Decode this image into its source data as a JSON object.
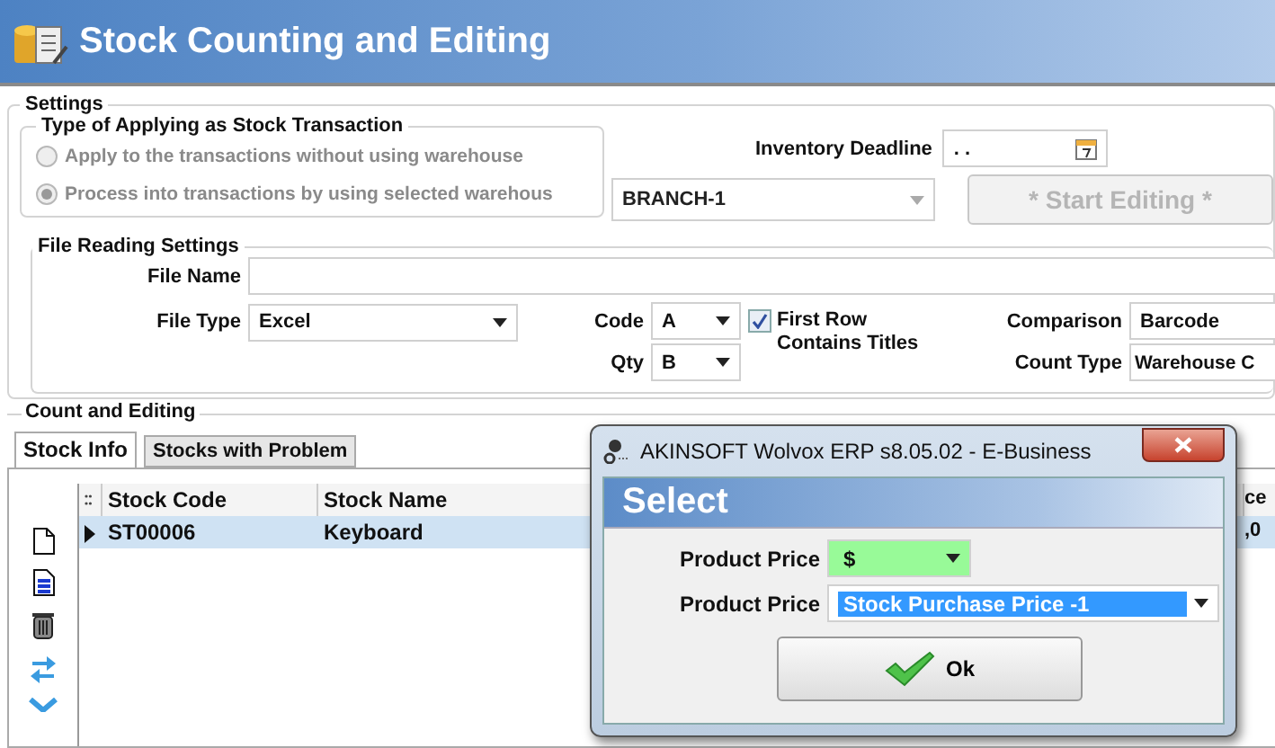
{
  "header": {
    "title": "Stock Counting and Editing"
  },
  "settings": {
    "legend": "Settings",
    "apply_type": {
      "legend": "Type of Applying as Stock Transaction",
      "disabled": true,
      "options": [
        {
          "label": "Apply to the transactions without using warehouse",
          "selected": false
        },
        {
          "label": "Process into transactions by using selected warehous",
          "selected": true
        }
      ]
    },
    "inventory_deadline": {
      "label": "Inventory Deadline",
      "value": ". ."
    },
    "warehouse": {
      "value": "BRANCH-1",
      "disabled": true
    },
    "start_button": {
      "label": "* Start Editing *",
      "disabled": true
    },
    "file_reading": {
      "legend": "File Reading Settings",
      "file_name": {
        "label": "File Name"
      },
      "file_type": {
        "label": "File Type",
        "value": "Excel"
      },
      "code": {
        "label": "Code",
        "value": "A"
      },
      "qty": {
        "label": "Qty",
        "value": "B"
      },
      "first_row_titles": {
        "label": "First Row Contains Titles",
        "checked": true
      },
      "comparison": {
        "label": "Comparison",
        "value": "Barcode"
      },
      "count_type": {
        "label": "Count Type",
        "value": "Warehouse C"
      }
    }
  },
  "count_editing": {
    "legend": "Count and Editing",
    "tabs": [
      {
        "label": "Stock Info",
        "selected": true
      },
      {
        "label": "Stocks with Problem",
        "selected": false
      }
    ],
    "grid": {
      "columns": [
        "Stock Code",
        "Stock Name",
        "ce"
      ],
      "rows": [
        {
          "cells": [
            "ST00006",
            "Keyboard",
            ",0"
          ],
          "selected": true
        }
      ]
    }
  },
  "dialog": {
    "title": "AKINSOFT Wolvox ERP s8.05.02 - E-Business",
    "heading": "Select",
    "fields": [
      {
        "label": "Product Price",
        "value": "$",
        "color": "#98fa98",
        "selected": false
      },
      {
        "label": "Product Price",
        "value": "Stock Purchase Price -1",
        "color": "#ffffff",
        "selected": true
      }
    ],
    "ok_button": {
      "label": "Ok"
    }
  }
}
